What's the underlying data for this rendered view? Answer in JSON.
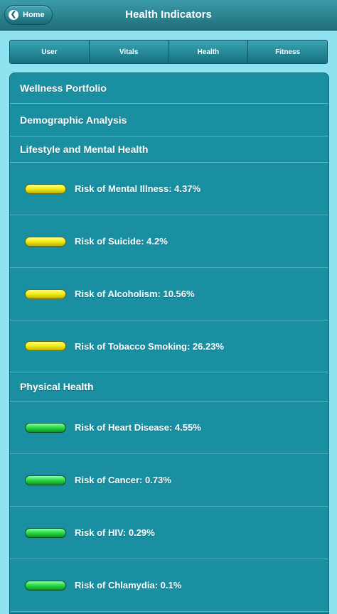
{
  "header": {
    "home_label": "Home",
    "home_icon": "chevron-left-icon",
    "title": "Health Indicators"
  },
  "tabs": [
    {
      "label": "User"
    },
    {
      "label": "Vitals"
    },
    {
      "label": "Health"
    },
    {
      "label": "Fitness"
    }
  ],
  "sections": {
    "wellness": "Wellness Portfolio",
    "demographic": "Demographic Analysis",
    "lifestyle": "Lifestyle and Mental Health",
    "physical": "Physical Health"
  },
  "lifestyle_items": [
    {
      "label": "Risk of Mental Illness: 4.37%",
      "indicator": "yellow"
    },
    {
      "label": "Risk of Suicide: 4.2%",
      "indicator": "yellow"
    },
    {
      "label": "Risk of Alcoholism: 10.56%",
      "indicator": "yellow"
    },
    {
      "label": "Risk of Tobacco Smoking: 26.23%",
      "indicator": "yellow"
    }
  ],
  "physical_items": [
    {
      "label": "Risk of Heart Disease: 4.55%",
      "indicator": "green"
    },
    {
      "label": "Risk of Cancer: 0.73%",
      "indicator": "green"
    },
    {
      "label": "Risk of HIV: 0.29%",
      "indicator": "green"
    },
    {
      "label": "Risk of Chlamydia: 0.1%",
      "indicator": "green"
    }
  ],
  "colors": {
    "background": "#8fe3f1",
    "panel": "#1a8fa1",
    "header": "#1f6f7c",
    "indicator_yellow": "#f3ef1a",
    "indicator_green": "#2edc4a"
  }
}
